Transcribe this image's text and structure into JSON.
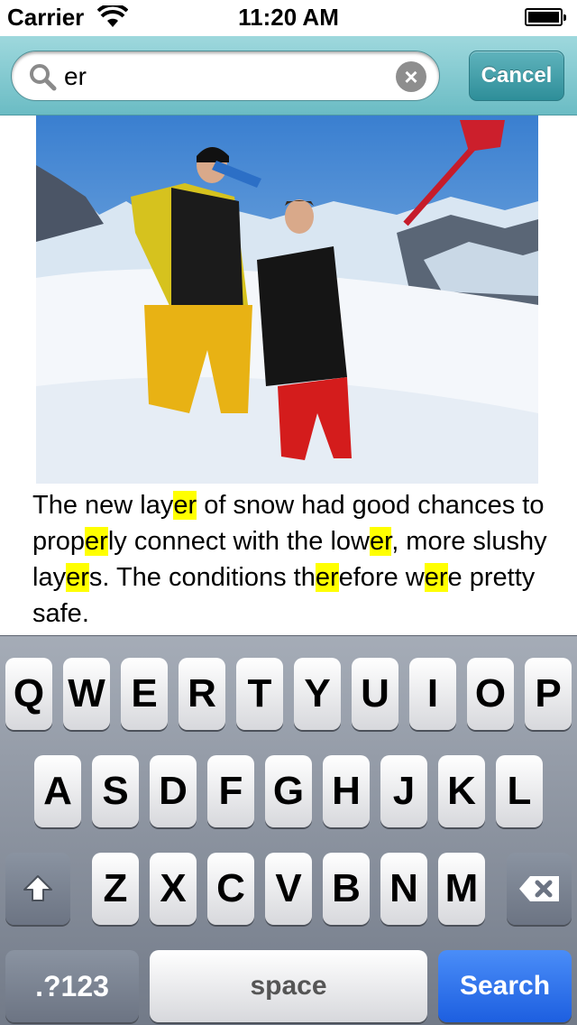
{
  "status_bar": {
    "carrier": "Carrier",
    "time": "11:20 AM"
  },
  "search": {
    "query": "er",
    "clear_icon": "×",
    "cancel_label": "Cancel"
  },
  "article": {
    "image_icon": "snowboarders-photo",
    "segments": [
      {
        "t": "The new lay",
        "h": false
      },
      {
        "t": "er",
        "h": true
      },
      {
        "t": " of snow had good chances to prop",
        "h": false
      },
      {
        "t": "er",
        "h": true
      },
      {
        "t": "ly connect with the low",
        "h": false
      },
      {
        "t": "er",
        "h": true
      },
      {
        "t": ", more slushy lay",
        "h": false
      },
      {
        "t": "er",
        "h": true
      },
      {
        "t": "s. The conditions th",
        "h": false
      },
      {
        "t": "er",
        "h": true
      },
      {
        "t": "efore w",
        "h": false
      },
      {
        "t": "er",
        "h": true
      },
      {
        "t": "e pretty safe.",
        "h": false
      }
    ],
    "highlight_color": "#ffff00"
  },
  "keyboard": {
    "row1": [
      "Q",
      "W",
      "E",
      "R",
      "T",
      "Y",
      "U",
      "I",
      "O",
      "P"
    ],
    "row2": [
      "A",
      "S",
      "D",
      "F",
      "G",
      "H",
      "J",
      "K",
      "L"
    ],
    "row3": [
      "Z",
      "X",
      "C",
      "V",
      "B",
      "N",
      "M"
    ],
    "shift_icon": "shift-arrow-icon",
    "backspace_icon": "backspace-icon",
    "numbers_label": ".?123",
    "space_label": "space",
    "search_label": "Search"
  },
  "colors": {
    "search_bar": "#7fc8cf",
    "search_key": "#1d5fe0"
  }
}
